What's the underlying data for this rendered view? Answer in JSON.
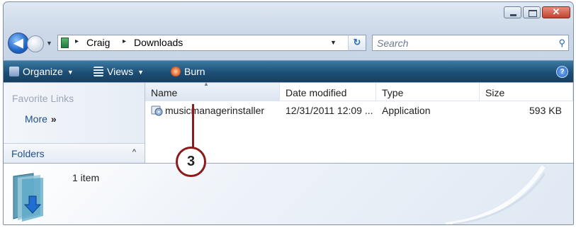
{
  "window": {
    "caption_buttons": {
      "minimize": "",
      "maximize": "",
      "close": "✕"
    }
  },
  "address": {
    "crumbs": [
      "Craig",
      "Downloads"
    ],
    "separator": "▸",
    "refresh_glyph": "↻",
    "search_placeholder": "Search",
    "search_icon": "⚲"
  },
  "toolbar": {
    "organize": "Organize",
    "views": "Views",
    "burn": "Burn",
    "help": "?"
  },
  "nav_pane": {
    "favorite_links": "Favorite Links",
    "more": "More",
    "more_glyph": "»",
    "folders": "Folders",
    "folders_caret": "^"
  },
  "file_list": {
    "columns": [
      "Name",
      "Date modified",
      "Type",
      "Size"
    ],
    "rows": [
      {
        "name": "musicmanagerinstaller",
        "date_modified": "12/31/2011 12:09 ...",
        "type": "Application",
        "size": "593 KB"
      }
    ]
  },
  "details": {
    "item_count": "1 item"
  },
  "callout": {
    "number": "3"
  },
  "colors": {
    "toolbar": "#1d4e75",
    "callout": "#8b1a1a",
    "link": "#1d4f91"
  }
}
